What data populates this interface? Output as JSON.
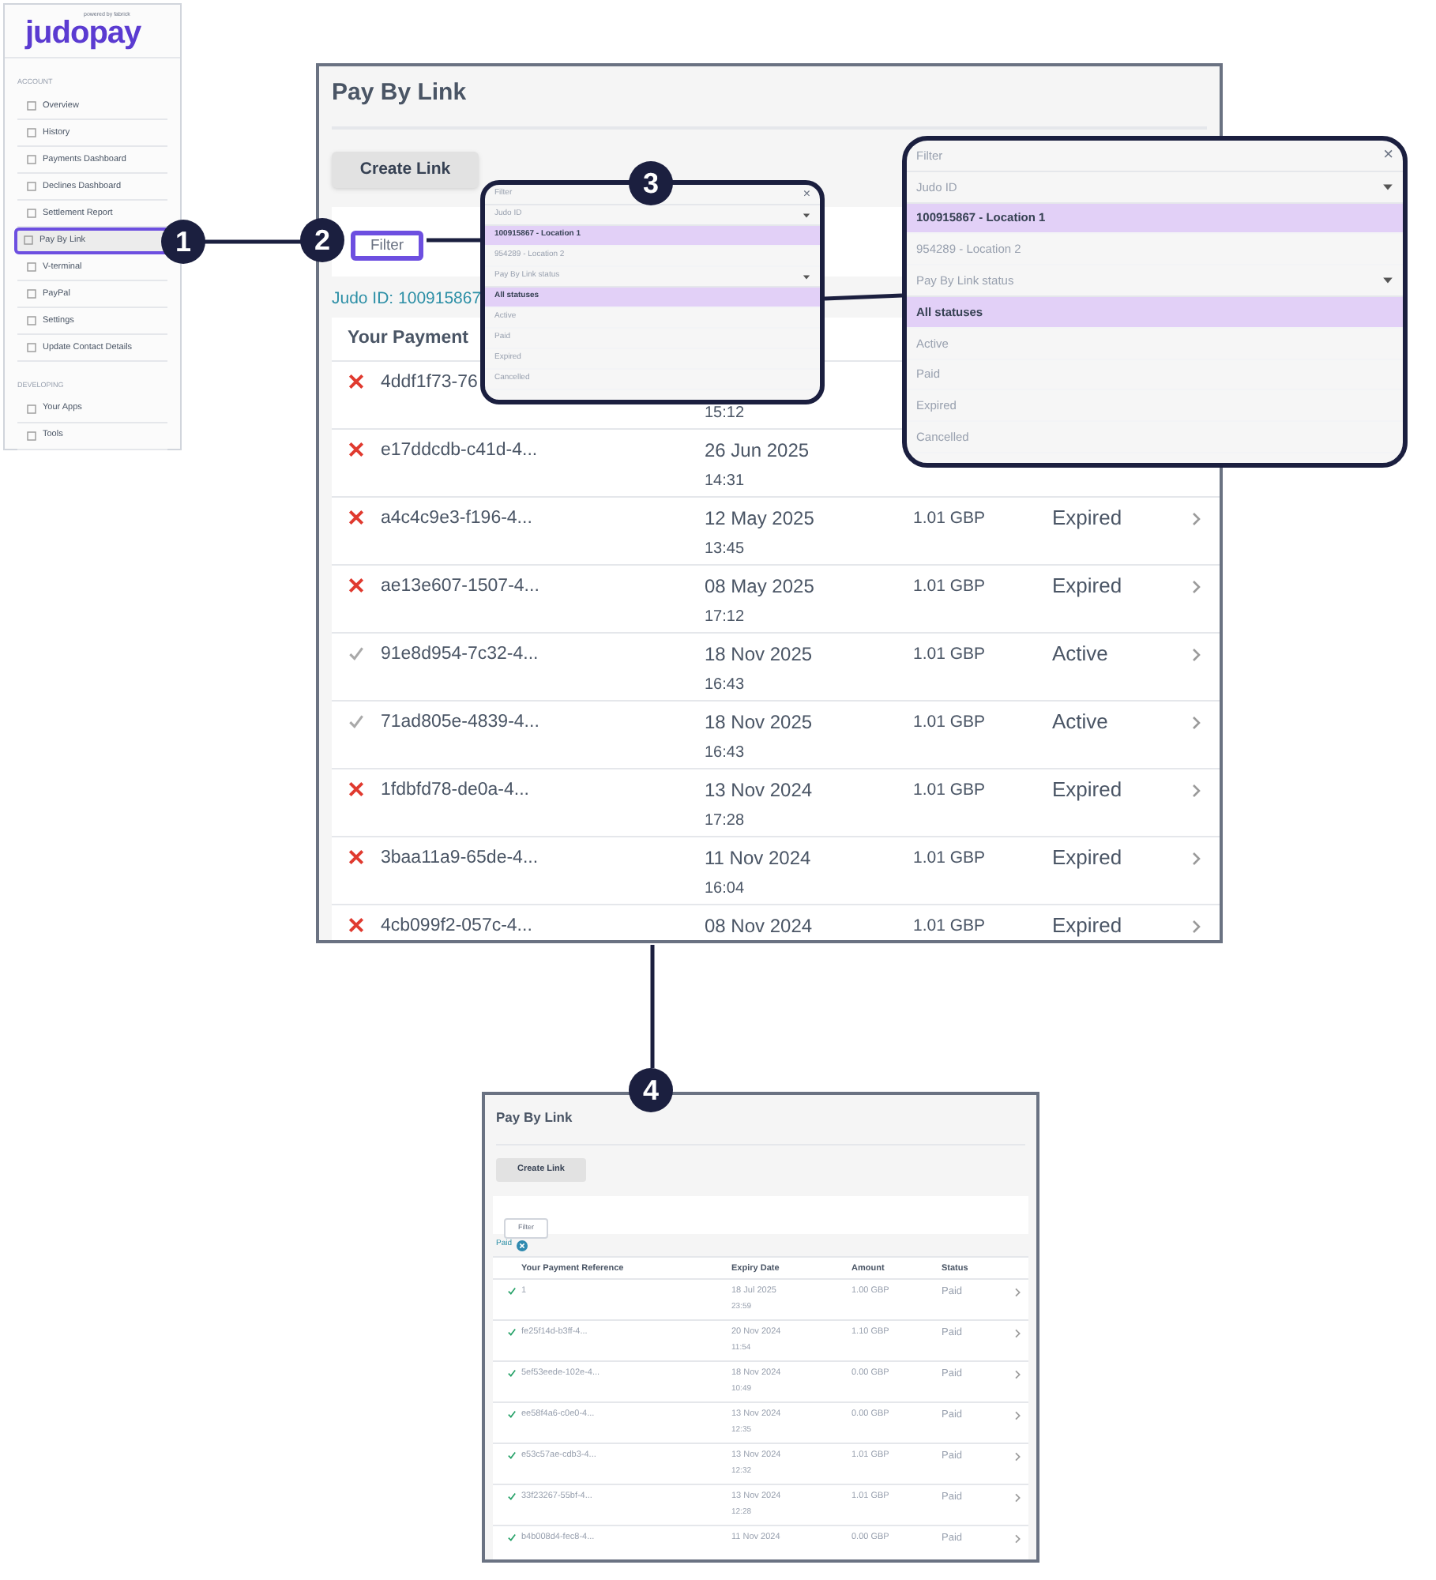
{
  "sidebar": {
    "logo": "judopay",
    "tagline": "powered by fabrick",
    "sections": [
      {
        "heading": "ACCOUNT",
        "items": [
          {
            "label": "Overview",
            "selected": false
          },
          {
            "label": "History",
            "selected": false
          },
          {
            "label": "Payments Dashboard",
            "selected": false
          },
          {
            "label": "Declines Dashboard",
            "selected": false
          },
          {
            "label": "Settlement Report",
            "selected": false
          },
          {
            "label": "Pay By Link",
            "selected": true
          },
          {
            "label": "V-terminal",
            "selected": false
          },
          {
            "label": "PayPal",
            "selected": false
          },
          {
            "label": "Settings",
            "selected": false
          },
          {
            "label": "Update Contact Details",
            "selected": false
          }
        ]
      },
      {
        "heading": "DEVELOPING",
        "items": [
          {
            "label": "Your Apps",
            "selected": false
          },
          {
            "label": "Tools",
            "selected": false
          }
        ]
      }
    ]
  },
  "callouts": [
    "1",
    "2",
    "3",
    "4"
  ],
  "main_panel": {
    "title": "Pay By Link",
    "create_button": "Create Link",
    "filter_button": "Filter",
    "judo_id": "Judo ID: 100915867",
    "columns": [
      "Your Payment"
    ],
    "rows": [
      {
        "kind": "cross",
        "reference": "4ddf1f73-76",
        "time": "15:12"
      },
      {
        "kind": "cross",
        "reference": "e17ddcdb-c41d-4...",
        "date": "26 Jun 2025",
        "time": "14:31"
      },
      {
        "kind": "cross",
        "reference": "a4c4c9e3-f196-4...",
        "date": "12 May 2025",
        "time": "13:45",
        "amount": "1.01 GBP",
        "status": "Expired"
      },
      {
        "kind": "cross",
        "reference": "ae13e607-1507-4...",
        "date": "08 May 2025",
        "time": "17:12",
        "amount": "1.01 GBP",
        "status": "Expired"
      },
      {
        "kind": "check",
        "reference": "91e8d954-7c32-4...",
        "date": "18 Nov 2025",
        "time": "16:43",
        "amount": "1.01 GBP",
        "status": "Active"
      },
      {
        "kind": "check",
        "reference": "71ad805e-4839-4...",
        "date": "18 Nov 2025",
        "time": "16:43",
        "amount": "1.01 GBP",
        "status": "Active"
      },
      {
        "kind": "cross",
        "reference": "1fdbfd78-de0a-4...",
        "date": "13 Nov 2024",
        "time": "17:28",
        "amount": "1.01 GBP",
        "status": "Expired"
      },
      {
        "kind": "cross",
        "reference": "3baa11a9-65de-4...",
        "date": "11 Nov 2024",
        "time": "16:04",
        "amount": "1.01 GBP",
        "status": "Expired"
      },
      {
        "kind": "cross",
        "reference": "4cb099f2-057c-4...",
        "date": "08 Nov 2024",
        "amount": "1.01 GBP",
        "status": "Expired"
      }
    ]
  },
  "filter_small": {
    "title": "Filter",
    "close": "×",
    "groups": [
      {
        "label": "Judo ID",
        "options": [
          {
            "label": "100915867 - Location 1",
            "selected": true
          },
          {
            "label": "954289 - Location 2",
            "selected": false
          }
        ]
      },
      {
        "label": "Pay By Link status",
        "options": [
          {
            "label": "All statuses",
            "selected": true
          },
          {
            "label": "Active",
            "selected": false
          },
          {
            "label": "Paid",
            "selected": false
          },
          {
            "label": "Expired",
            "selected": false
          },
          {
            "label": "Cancelled",
            "selected": false
          }
        ]
      }
    ]
  },
  "filter_zoomed": {
    "title": "Filter",
    "close": "×",
    "groups": [
      {
        "label": "Judo ID",
        "options": [
          {
            "label": "100915867 - Location 1",
            "selected": true
          },
          {
            "label": "954289 - Location 2",
            "selected": false
          }
        ]
      },
      {
        "label": "Pay By Link status",
        "options": [
          {
            "label": "All statuses",
            "selected": true
          },
          {
            "label": "Active",
            "selected": false
          },
          {
            "label": "Paid",
            "selected": false
          },
          {
            "label": "Expired",
            "selected": false
          },
          {
            "label": "Cancelled",
            "selected": false
          }
        ]
      }
    ]
  },
  "result_panel": {
    "title": "Pay By Link",
    "create_button": "Create Link",
    "filter_button": "Filter",
    "active_filter": "Paid",
    "columns": [
      "Your Payment Reference",
      "Expiry Date",
      "Amount",
      "Status"
    ],
    "rows": [
      {
        "kind": "check",
        "reference": "1",
        "date": "18 Jul 2025",
        "time": "23:59",
        "amount": "1.00 GBP",
        "status": "Paid"
      },
      {
        "kind": "check",
        "reference": "fe25f14d-b3ff-4...",
        "date": "20 Nov 2024",
        "time": "11:54",
        "amount": "1.10 GBP",
        "status": "Paid"
      },
      {
        "kind": "check",
        "reference": "5ef53eede-102e-4...",
        "date": "18 Nov 2024",
        "time": "10:49",
        "amount": "0.00 GBP",
        "status": "Paid"
      },
      {
        "kind": "check",
        "reference": "ee58f4a6-c0e0-4...",
        "date": "13 Nov 2024",
        "time": "12:35",
        "amount": "0.00 GBP",
        "status": "Paid"
      },
      {
        "kind": "check",
        "reference": "e53c57ae-cdb3-4...",
        "date": "13 Nov 2024",
        "time": "12:32",
        "amount": "1.01 GBP",
        "status": "Paid"
      },
      {
        "kind": "check",
        "reference": "33f23267-55bf-4...",
        "date": "13 Nov 2024",
        "time": "12:28",
        "amount": "1.01 GBP",
        "status": "Paid"
      },
      {
        "kind": "check",
        "reference": "b4b008d4-fec8-4...",
        "date": "11 Nov 2024",
        "amount": "0.00 GBP",
        "status": "Paid"
      }
    ]
  }
}
